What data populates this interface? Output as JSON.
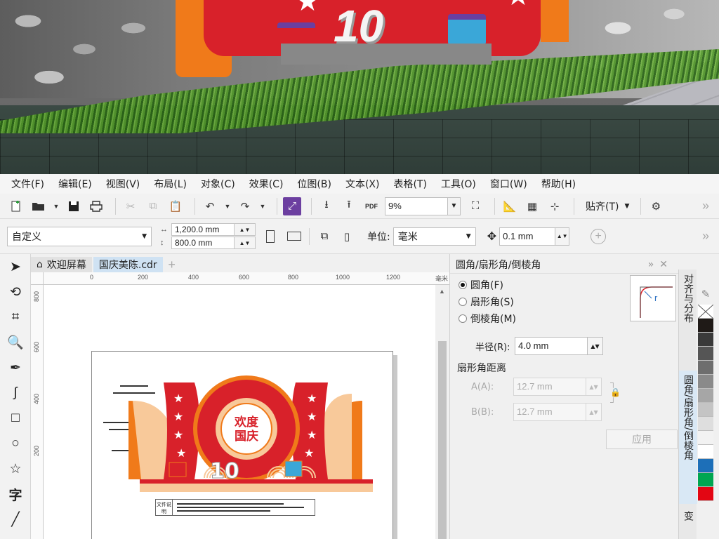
{
  "menubar": {
    "items": [
      "文件(F)",
      "编辑(E)",
      "视图(V)",
      "布局(L)",
      "对象(C)",
      "效果(C)",
      "位图(B)",
      "文本(X)",
      "表格(T)",
      "工具(O)",
      "窗口(W)",
      "帮助(H)"
    ]
  },
  "banner": {
    "sign_number": "10"
  },
  "toolbar": {
    "zoom_value": "9%",
    "snap_label": "贴齐(T)",
    "pdf_label": "PDF"
  },
  "propertybar": {
    "page_preset": "自定义",
    "width": "1,200.0 mm",
    "height": "800.0 mm",
    "units_label": "单位:",
    "units_value": "毫米",
    "nudge": "0.1 mm"
  },
  "doc_tabs": {
    "welcome": "欢迎屏幕",
    "file": "国庆美陈.cdr"
  },
  "ruler": {
    "h_ticks": [
      "0",
      "200",
      "400",
      "600",
      "800",
      "1000",
      "1200"
    ],
    "unit": "毫米",
    "v_ticks": [
      "800",
      "600",
      "400",
      "200"
    ]
  },
  "design": {
    "badge_line1": "欢度",
    "badge_line2": "国庆",
    "file_label": "文件说明",
    "number": "10"
  },
  "docker": {
    "title": "圆角/扇形角/倒棱角",
    "options": [
      "圆角(F)",
      "扇形角(S)",
      "倒棱角(M)"
    ],
    "selected_option": "圆角(F)",
    "radius_label": "半径(R):",
    "radius_value": "4.0 mm",
    "scallop_section": "扇形角距离",
    "a_label": "A(A):",
    "a_value": "12.7 mm",
    "b_label": "B(B):",
    "b_value": "12.7 mm",
    "apply_label": "应用",
    "preview_letter": "r"
  },
  "docker_tabs": {
    "align": "对齐与分布",
    "fillet": "圆角/扇形角/倒棱角",
    "transform": "变"
  },
  "palette": {
    "colors": [
      "#ffffff",
      "#e6e6e6",
      "#1f1a17",
      "#3a3a3a",
      "#555555",
      "#6e6e6e",
      "#8a8a8a",
      "#a6a6a6",
      "#c4c4c4",
      "#dedede",
      "#f2f2f2",
      "#ffffff",
      "#1d6fb8",
      "#00a651",
      "#e30613"
    ]
  },
  "colors": {
    "red": "#d8212a",
    "orange": "#f07a1a",
    "peach": "#f8c99a",
    "accent_purple": "#6c3fa0"
  }
}
